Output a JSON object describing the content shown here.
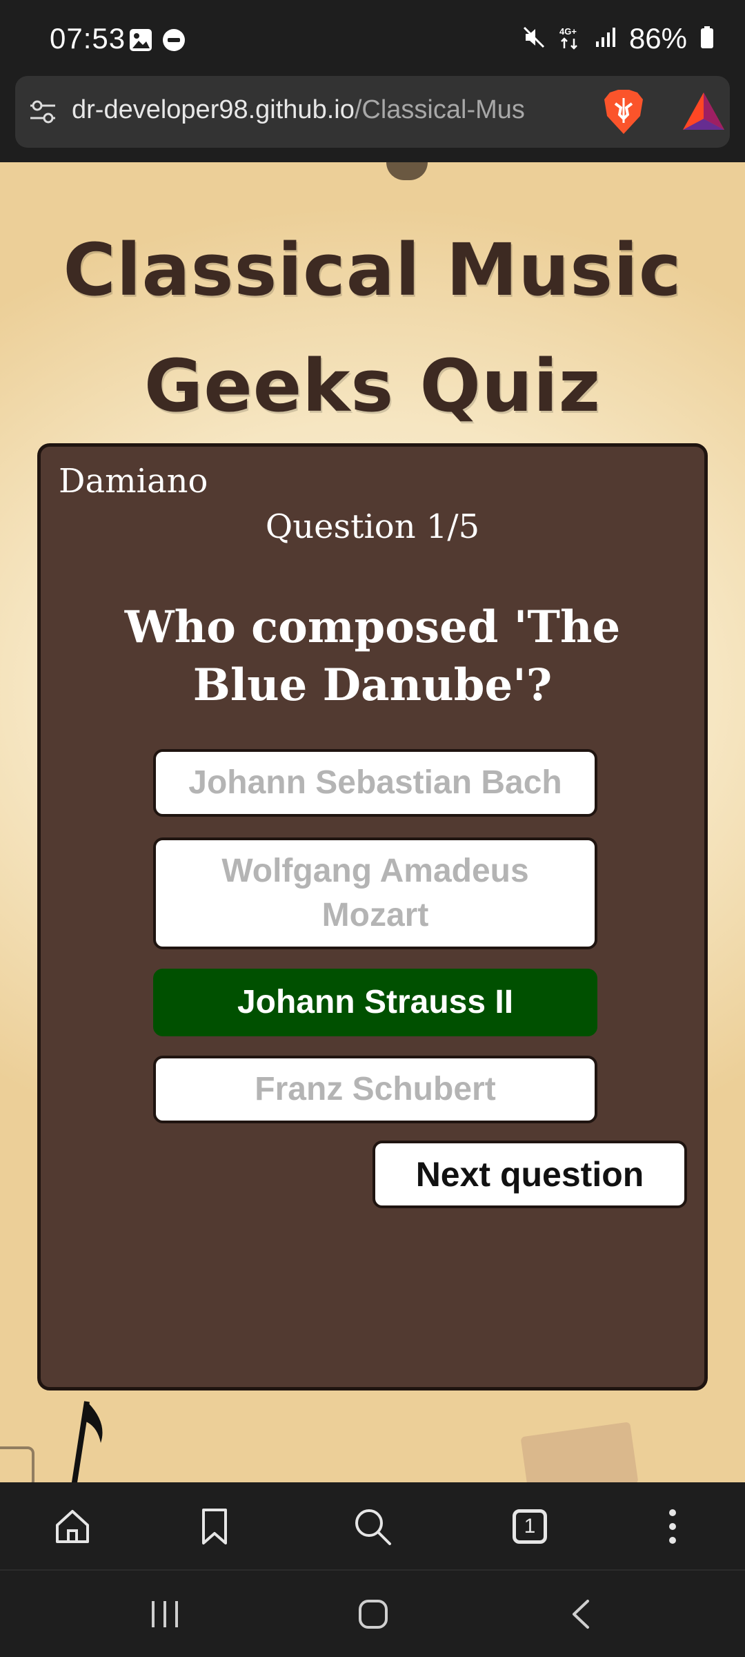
{
  "status_bar": {
    "time": "07:53",
    "battery": "86%",
    "network": "4G+"
  },
  "browser": {
    "url_host": "dr-developer98.github.io",
    "url_path": "/Classical-Mus",
    "tab_count": "1"
  },
  "page": {
    "title": "Classical Music Geeks Quiz"
  },
  "quiz": {
    "player_name": "Damiano",
    "question_counter": "Question 1/5",
    "question": "Who composed 'The Blue Danube'?",
    "answers": [
      {
        "label": "Johann Sebastian Bach",
        "state": "disabled"
      },
      {
        "label": "Wolfgang Amadeus Mozart",
        "state": "disabled"
      },
      {
        "label": "Johann Strauss II",
        "state": "correct"
      },
      {
        "label": "Franz Schubert",
        "state": "disabled"
      }
    ],
    "next_label": "Next question"
  },
  "colors": {
    "card_bg": "#523a31",
    "correct_bg": "#005000",
    "title_color": "#3d2a22"
  },
  "icons": {
    "toolbar": [
      "home-icon",
      "bookmark-icon",
      "search-icon",
      "tabs-icon",
      "more-icon"
    ],
    "system_nav": [
      "recents-icon",
      "home-nav-icon",
      "back-icon"
    ]
  }
}
